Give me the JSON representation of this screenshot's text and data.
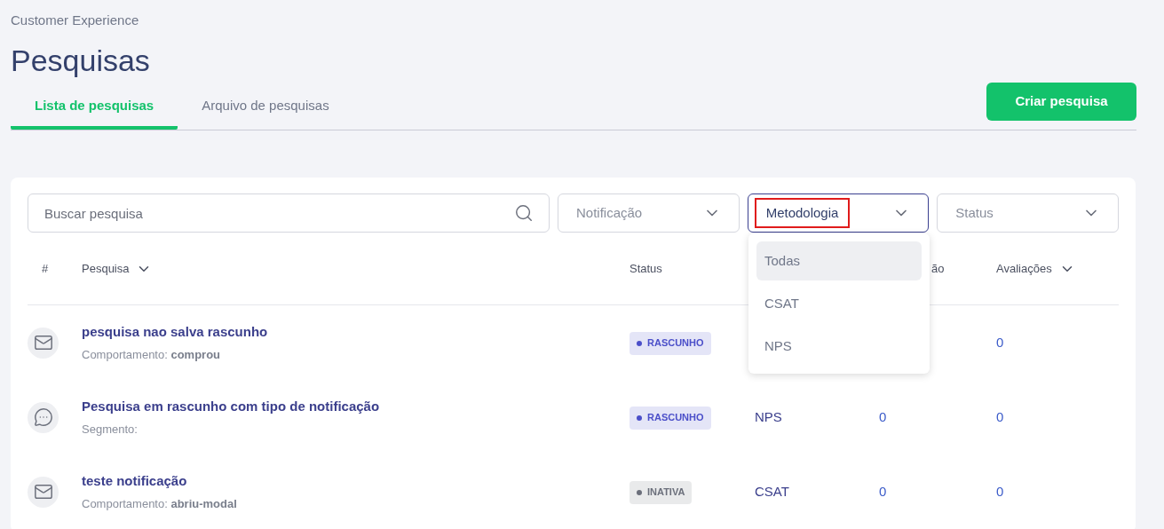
{
  "breadcrumb": "Customer Experience",
  "title": "Pesquisas",
  "tabs": [
    {
      "label": "Lista de pesquisas",
      "selected": true
    },
    {
      "label": "Arquivo de pesquisas",
      "selected": false
    }
  ],
  "create_button": "Criar pesquisa",
  "search": {
    "placeholder": "Buscar pesquisa"
  },
  "filters": [
    {
      "label": "Notificação",
      "open": false,
      "highlighted": false
    },
    {
      "label": "Metodologia",
      "open": true,
      "highlighted": true
    },
    {
      "label": "Status",
      "open": false,
      "highlighted": false
    }
  ],
  "dropdown_options": [
    {
      "label": "Todas",
      "selected": true
    },
    {
      "label": "CSAT",
      "selected": false
    },
    {
      "label": "NPS",
      "selected": false
    }
  ],
  "table": {
    "columns": [
      {
        "label": "#",
        "sortable": false
      },
      {
        "label": "Pesquisa",
        "sortable": true
      },
      {
        "label": "Status",
        "sortable": false
      },
      {
        "label": "ão",
        "sortable": false
      },
      {
        "label": "Avaliações",
        "sortable": true
      }
    ],
    "rows": [
      {
        "kind": "email",
        "name": "pesquisa nao salva rascunho",
        "detail_label": "Comportamento:",
        "detail_value": "comprou",
        "status": "RASCUNHO",
        "color": "#4b4fc9",
        "column_5": "0"
      },
      {
        "kind": "chat",
        "name": "Pesquisa em rascunho com tipo de notificação",
        "detail_label": "Segmento:",
        "status": "RASCUNHO",
        "color": "#4b4fc9",
        "methodology": "NPS",
        "column_4": "0",
        "column_5": "0"
      },
      {
        "kind": "email",
        "name": "teste notificação",
        "detail_label": "Comportamento:",
        "detail_value": "abriu-modal",
        "status": "INATIVA",
        "color": "#6b6f7b",
        "methodology": "CSAT",
        "column_4": "0",
        "column_5": "0"
      }
    ]
  }
}
